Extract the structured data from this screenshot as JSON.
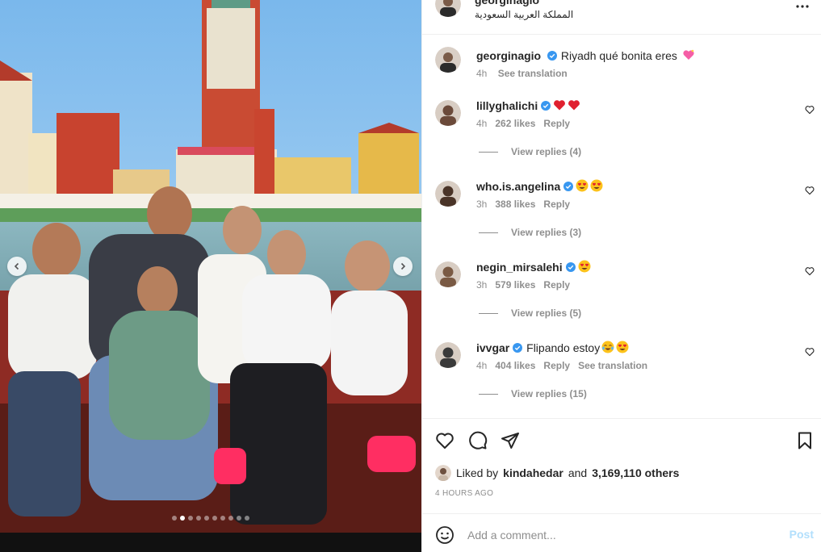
{
  "post": {
    "username": "georginagio",
    "location": "المملكة العربية السعودية",
    "caption": {
      "username": "georginagio",
      "text": "Riyadh qué bonita eres",
      "emoji": "heart-sparkle",
      "time": "4h",
      "see_translation": "See translation"
    },
    "carousel": {
      "dot_count": 10,
      "active_index": 1
    }
  },
  "comments": [
    {
      "username": "lillyghalichi",
      "verified": true,
      "text": "",
      "emojis": [
        "red-heart",
        "red-heart"
      ],
      "time": "4h",
      "likes": "262 likes",
      "reply": "Reply",
      "view_replies": "View replies (4)",
      "avatar_color": "#6b4a3a"
    },
    {
      "username": "who.is.angelina",
      "verified": true,
      "text": "",
      "emojis": [
        "heart-eyes",
        "heart-eyes"
      ],
      "time": "3h",
      "likes": "388 likes",
      "reply": "Reply",
      "view_replies": "View replies (3)",
      "avatar_color": "#4a3428"
    },
    {
      "username": "negin_mirsalehi",
      "verified": true,
      "text": "",
      "emojis": [
        "heart-eyes"
      ],
      "time": "3h",
      "likes": "579 likes",
      "reply": "Reply",
      "view_replies": "View replies (5)",
      "avatar_color": "#7a5a44"
    },
    {
      "username": "ivvgar",
      "verified": true,
      "text": "Flipando estoy",
      "emojis": [
        "tears-of-joy",
        "heart-eyes"
      ],
      "time": "4h",
      "likes": "404 likes",
      "reply": "Reply",
      "see_translation": "See translation",
      "view_replies": "View replies (15)",
      "avatar_color": "#3a3a3a"
    }
  ],
  "likes": {
    "prefix": "Liked by",
    "user": "kindahedar",
    "and": "and",
    "count": "3,169,110 others"
  },
  "timestamp": "4 HOURS AGO",
  "comment_input": {
    "placeholder": "Add a comment..."
  },
  "post_button": "Post",
  "colors": {
    "verified": "#3897f0",
    "muted": "#8e8e8e",
    "post_disabled": "#b2dffc",
    "heart_red": "#ed4956"
  }
}
